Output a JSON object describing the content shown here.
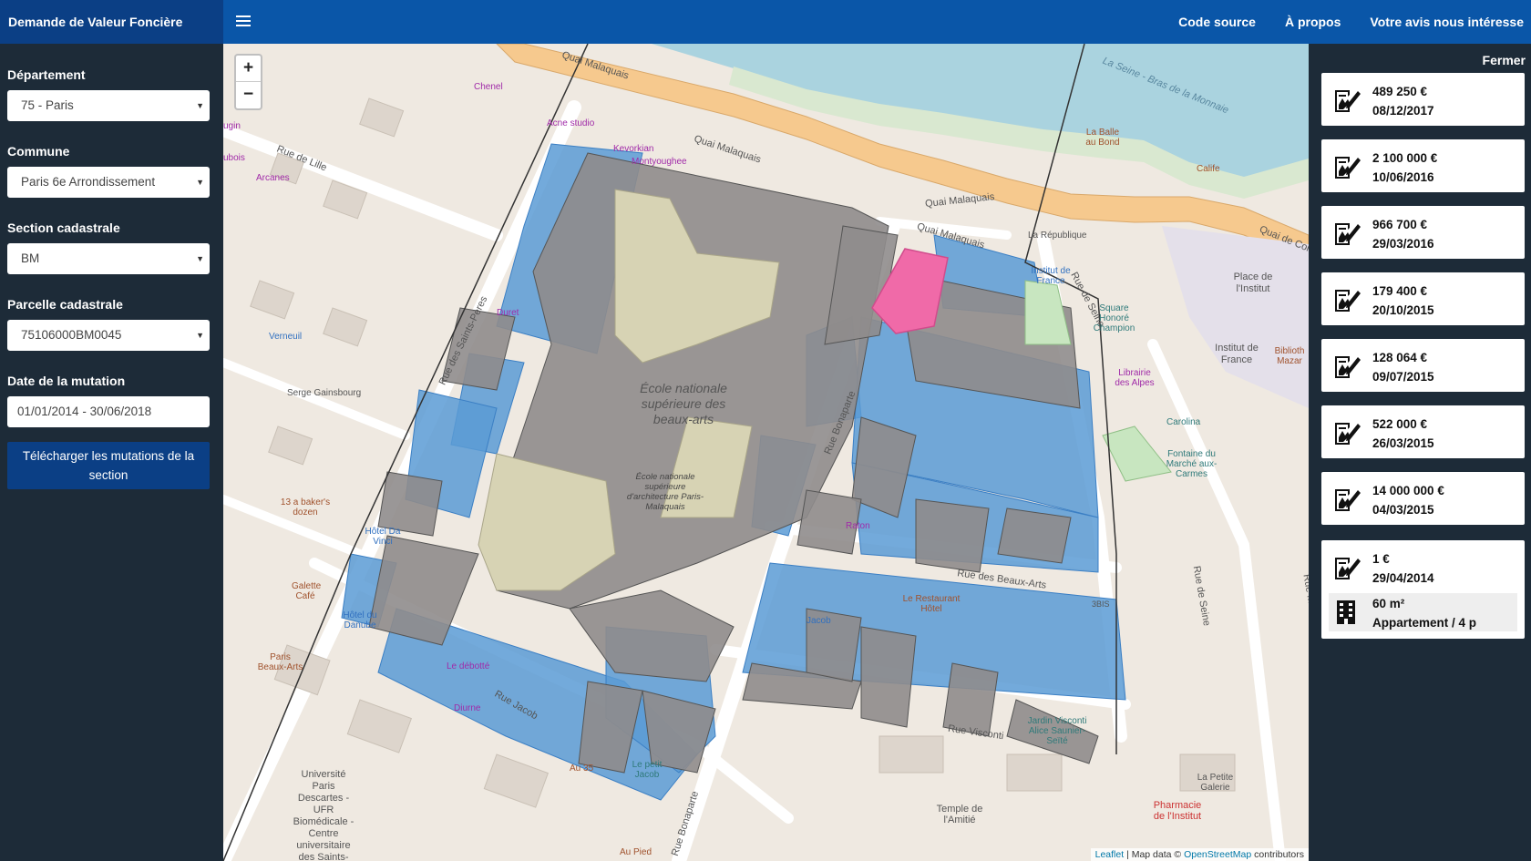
{
  "navbar": {
    "brand": "Demande de Valeur Foncière",
    "links": [
      "Code source",
      "À propos",
      "Votre avis nous intéresse"
    ]
  },
  "sidebar": {
    "departement": {
      "label": "Département",
      "value": "75 - Paris"
    },
    "commune": {
      "label": "Commune",
      "value": "Paris 6e Arrondissement"
    },
    "section": {
      "label": "Section cadastrale",
      "value": "BM"
    },
    "parcelle": {
      "label": "Parcelle cadastrale",
      "value": "75106000BM0045"
    },
    "date": {
      "label": "Date de la mutation",
      "value": "01/01/2014 - 30/06/2018"
    },
    "download_label": "Télécharger les mutations de la section"
  },
  "map": {
    "zoom_in": "+",
    "zoom_out": "−",
    "attribution": {
      "leaflet": "Leaflet",
      "mid": " | Map data © ",
      "osm": "OpenStreetMap",
      "end": " contributors"
    },
    "labels": {
      "quai_malaquais_1": "Quai Malaquais",
      "quai_malaquais_2": "Quai Malaquais",
      "quai_malaquais_3": "Quai Malaquais",
      "quai_malaquais_4": "Quai Malaquais",
      "quai_de_conti": "Quai de Conti",
      "la_seine": "La Seine - Bras de la Monnaie",
      "rue_de_lille": "Rue de Lille",
      "rue_des_saints_peres": "Rue des Saints-Pères",
      "rue_bonaparte_1": "Rue Bonaparte",
      "rue_bonaparte_2": "Rue Bonaparte",
      "rue_de_seine_1": "Rue de Seine",
      "rue_de_seine_2": "Rue de Seine",
      "rue_des_beaux_arts": "Rue des Beaux-Arts",
      "rue_visconti": "Rue Visconti",
      "rue_jacob": "Rue Jacob",
      "rue_mazarine": "Rue Mazarine",
      "ecole": "École nationale supérieure des beaux-arts",
      "ecole_archi": "École nationale supérieure d'architecture Paris-Malaquais",
      "place_institut": "Place de l'Institut",
      "institut_france": "Institut de France",
      "square_honore": "Square Honoré Champion",
      "fontaine": "Fontaine du Marché aux-Carmes",
      "universite": "Université Paris Descartes - UFR Biomédicale - Centre universitaire des Saints-",
      "temple": "Temple de l'Amitié",
      "pharmacie": "Pharmacie de l'Institut",
      "la_petite_galerie": "La Petite Galerie",
      "chenel": "Chenel",
      "acne": "Acne studio",
      "kevorkian": "Kevorkian",
      "montyoughee": "Montyoughee",
      "arcanes": "Arcanes",
      "verneuil": "Verneuil",
      "serge": "Serge Gainsbourg",
      "baker": "13 a baker's dozen",
      "hotel_da_vinci": "Hôtel Da Vinci",
      "galette": "Galette Café",
      "hotel_danube": "Hôtel du Danube",
      "paris_beaux_arts": "Paris Beaux-Arts",
      "le_debotte": "Le débotté",
      "diurne": "Diurne",
      "au35": "Au 35",
      "le_petit_jacob": "Le petit Jacob",
      "au_pied": "Au Pied",
      "jacob": "Jacob",
      "le_restaurant_hotel": "Le Restaurant Hôtel",
      "raton": "Raton",
      "duret": "Duret",
      "la_republique": "La République",
      "librairie": "Librairie des Alpes",
      "carolina": "Carolina",
      "calife": "Calife",
      "la_balle": "La Balle au Bond",
      "bibliotheque": "Biblioth Mazar",
      "institut_france_2": "Institut de France",
      "jardin_visconti": "Jardin Visconti Alice Saunier-Seïté",
      "bougin": "ugin",
      "dubois": "ubois",
      "bis3": "3BIS"
    }
  },
  "right_panel": {
    "close_label": "Fermer",
    "mutations": [
      {
        "price": "489 250 €",
        "date": "08/12/2017"
      },
      {
        "price": "2 100 000 €",
        "date": "10/06/2016"
      },
      {
        "price": "966 700 €",
        "date": "29/03/2016"
      },
      {
        "price": "179 400 €",
        "date": "20/10/2015"
      },
      {
        "price": "128 064 €",
        "date": "09/07/2015"
      },
      {
        "price": "522 000 €",
        "date": "26/03/2015"
      },
      {
        "price": "14 000 000 €",
        "date": "04/03/2015"
      },
      {
        "price": "1 €",
        "date": "29/04/2014",
        "detail": {
          "surface": "60 m²",
          "type": "Appartement / 4 p"
        }
      }
    ]
  },
  "colors": {
    "navbar": "#0a56a8",
    "brand_bg": "#0b3f85",
    "sidebar_bg": "#1d2b38",
    "parcel_blue": "#5b9bd5",
    "parcel_selected": "#f06aa8",
    "building_gray": "#8f8c8c"
  },
  "icons": {
    "mutation": "signed-document-icon",
    "building": "building-icon"
  }
}
